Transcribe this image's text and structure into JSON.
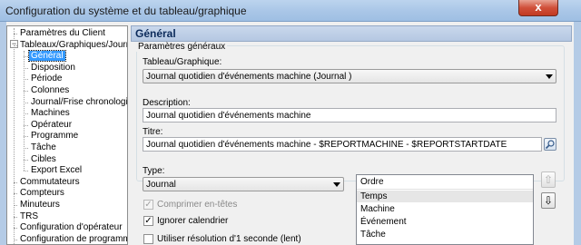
{
  "window": {
    "title": "Configuration du système et du tableau/graphique",
    "close_label": "x"
  },
  "tree": {
    "items": [
      {
        "label": "Paramètres du Client",
        "level": 0
      },
      {
        "label": "Tableaux/Graphiques/Journa",
        "level": 0
      },
      {
        "label": "Général",
        "level": 1,
        "selected": true
      },
      {
        "label": "Disposition",
        "level": 1
      },
      {
        "label": "Période",
        "level": 1
      },
      {
        "label": "Colonnes",
        "level": 1
      },
      {
        "label": "Journal/Frise chronologic",
        "level": 1
      },
      {
        "label": "Machines",
        "level": 1
      },
      {
        "label": "Opérateur",
        "level": 1
      },
      {
        "label": "Programme",
        "level": 1
      },
      {
        "label": "Tâche",
        "level": 1
      },
      {
        "label": "Cibles",
        "level": 1
      },
      {
        "label": "Export Excel",
        "level": 1
      },
      {
        "label": "Commutateurs",
        "level": 0
      },
      {
        "label": "Compteurs",
        "level": 0
      },
      {
        "label": "Minuteurs",
        "level": 0
      },
      {
        "label": "TRS",
        "level": 0
      },
      {
        "label": "Configuration d'opérateur",
        "level": 0
      },
      {
        "label": "Configuration de programme",
        "level": 0
      }
    ]
  },
  "panel": {
    "header": "Général",
    "group_title": "Paramètres généraux",
    "chart_label": "Tableau/Graphique:",
    "chart_value": "Journal quotidien d'événements machine  (Journal )",
    "description_label": "Description:",
    "description_value": "Journal quotidien d'événements machine",
    "title_label": "Titre:",
    "title_value": "Journal quotidien d'événements machine - $REPORTMACHINE - $REPORTSTARTDATE",
    "type_label": "Type:",
    "type_value": "Journal",
    "options": {
      "compress_headers": {
        "label": "Comprimer en-têtes",
        "checked": true,
        "enabled": false
      },
      "ignore_calendar": {
        "label": "Ignorer calendrier",
        "checked": true,
        "enabled": true
      },
      "one_second": {
        "label": "Utiliser résolution d'1 seconde (lent)",
        "checked": false,
        "enabled": true
      }
    },
    "order": {
      "header": "Ordre",
      "items": [
        "Temps",
        "Machine",
        "Événement",
        "Tâche"
      ]
    }
  }
}
